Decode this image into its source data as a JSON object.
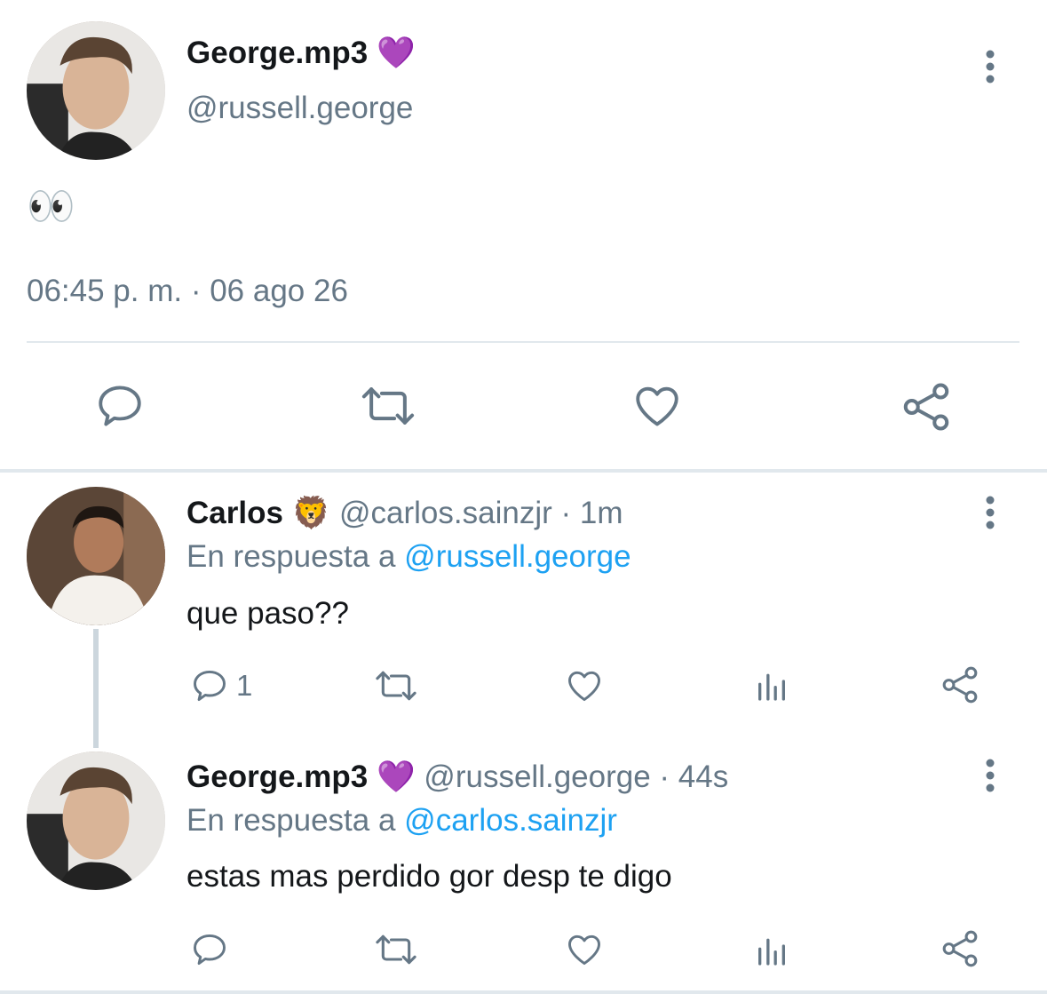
{
  "main_tweet": {
    "display_name": "George.mp3",
    "name_emoji": "💜",
    "handle": "@russell.george",
    "text": "👀",
    "timestamp": "06:45 p. m. · 06 ago 26",
    "actions": [
      "reply-icon",
      "retweet-icon",
      "like-icon",
      "share-icon"
    ]
  },
  "replies": [
    {
      "display_name": "Carlos",
      "name_emoji": "🦁",
      "meta": "@carlos.sainzjr · 1m",
      "reply_prefix": "En respuesta a",
      "reply_to": "@russell.george",
      "text": "que paso??",
      "reply_count": "1"
    },
    {
      "display_name": "George.mp3",
      "name_emoji": "💜",
      "meta": "@russell.george · 44s",
      "reply_prefix": "En respuesta a",
      "reply_to": "@carlos.sainzjr",
      "text": "estas mas perdido gor desp te digo",
      "reply_count": ""
    }
  ],
  "colors": {
    "icon": "#657786",
    "link": "#1da1f2",
    "divider": "#e1e8ed",
    "text": "#14171a"
  }
}
